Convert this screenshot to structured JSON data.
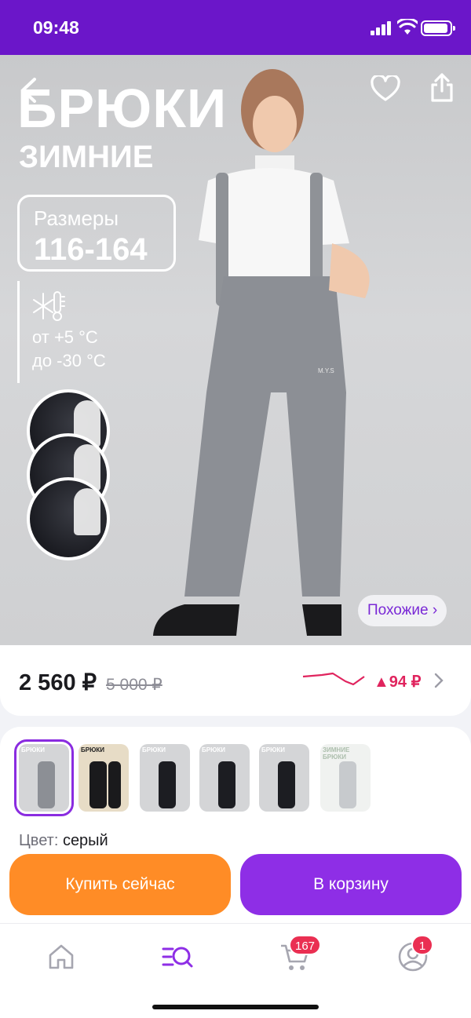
{
  "status": {
    "time": "09:48"
  },
  "product": {
    "title_line1": "БРЮКИ",
    "title_line2": "ЗИМНИЕ",
    "sizes_label": "Размеры",
    "sizes_value": "116-164",
    "temp_from": "от +5 °C",
    "temp_to": "до -30 °C",
    "similar_label": "Похожие ›",
    "brand_mark": "M.Y.S"
  },
  "pricing": {
    "price": "2 560 ₽",
    "old_price": "5 000 ₽",
    "change": "▲94 ₽"
  },
  "variants": {
    "thumb_title": "БРЮКИ",
    "thumb_sub": "ЗИМНИЕ",
    "thumb2_title": "БРЮКИ",
    "thumb6_title": "ЗИМНИЕ БРЮКИ",
    "color_label": "Цвет:",
    "color_value": "серый",
    "count": 6
  },
  "actions": {
    "buy_now": "Купить сейчас",
    "add_to_cart": "В корзину"
  },
  "tabbar": {
    "cart_badge": "167",
    "profile_badge": "1"
  },
  "colors": {
    "brand_purple": "#6b16c9",
    "buy_orange": "#ff8c26",
    "cart_purple": "#8e2ee6",
    "badge_red": "#ea2f52",
    "price_up": "#e0245e"
  },
  "icons": [
    "back-icon",
    "heart-icon",
    "share-icon",
    "snowflake-thermometer-icon",
    "home-icon",
    "catalog-search-icon",
    "cart-icon",
    "profile-icon",
    "chevron-right-icon"
  ]
}
